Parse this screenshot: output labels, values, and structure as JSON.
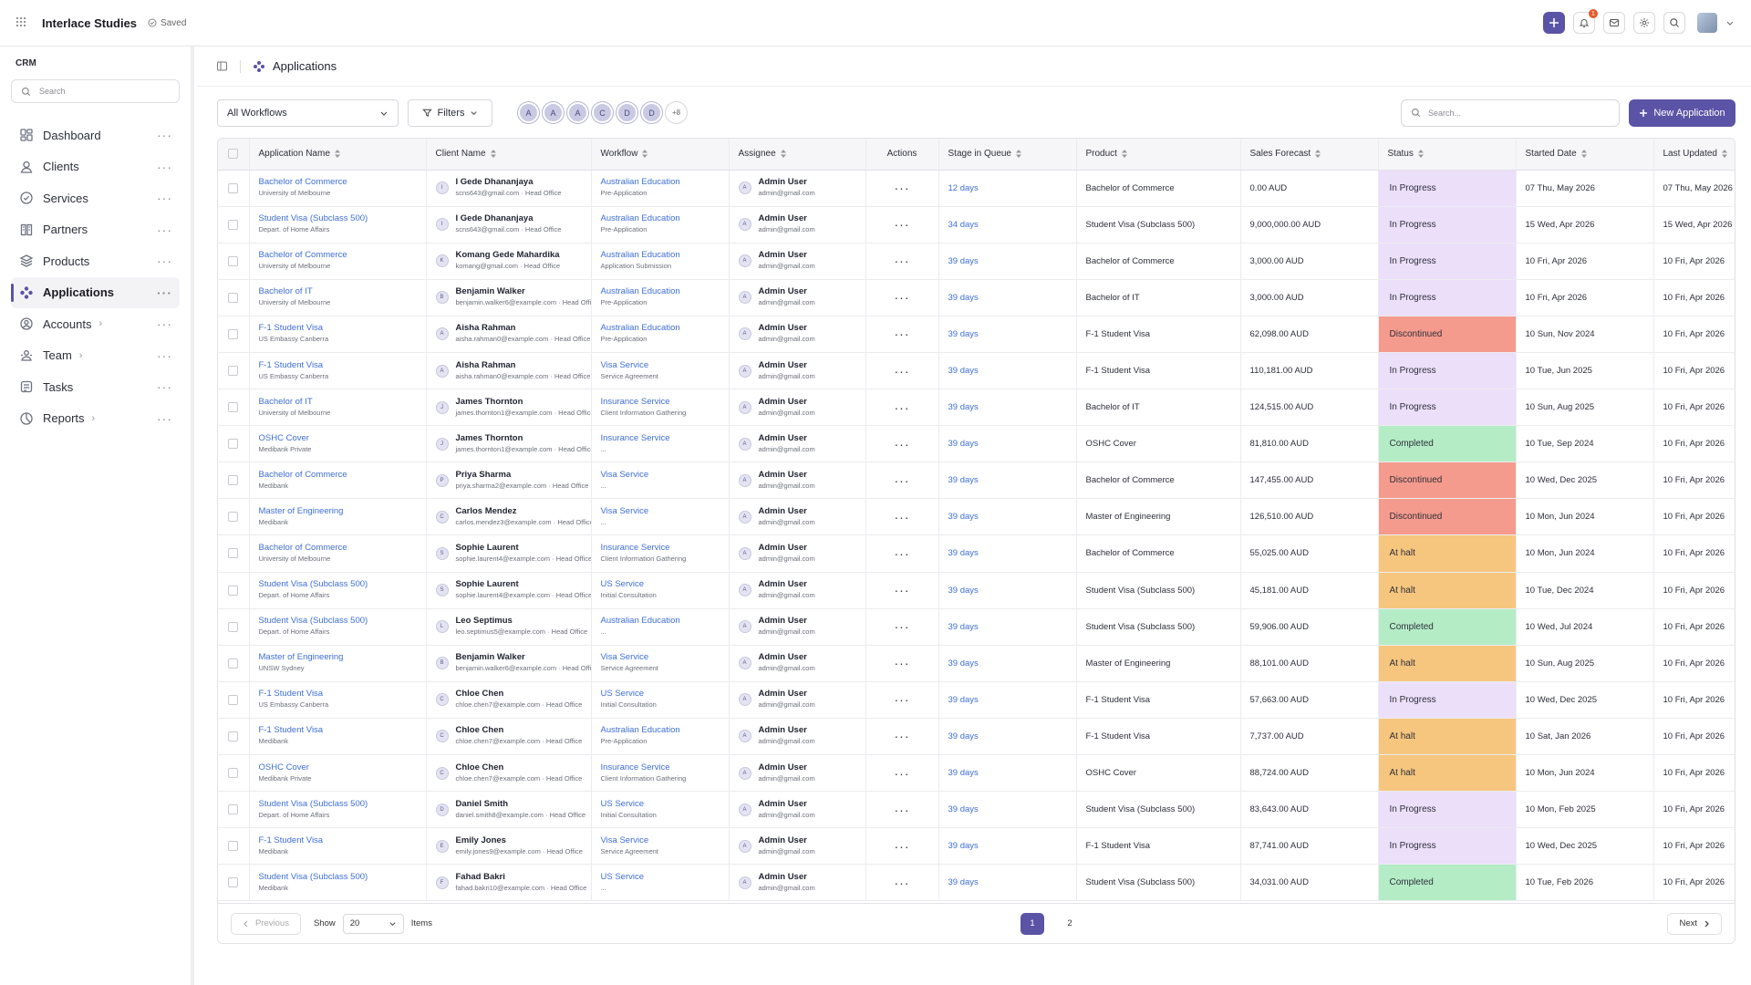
{
  "topbar": {
    "title": "Interlace Studies",
    "saved": "Saved",
    "notif_count": "1"
  },
  "sidebar": {
    "section": "CRM",
    "search_placeholder": "Search",
    "items": [
      {
        "label": "Dashboard",
        "icon": "dashboard-icon",
        "active": false
      },
      {
        "label": "Clients",
        "icon": "user-icon",
        "active": false
      },
      {
        "label": "Services",
        "icon": "check-circle-icon",
        "active": false
      },
      {
        "label": "Partners",
        "icon": "building-icon",
        "active": false
      },
      {
        "label": "Products",
        "icon": "layers-icon",
        "active": false
      },
      {
        "label": "Applications",
        "icon": "applications-icon",
        "active": true
      },
      {
        "label": "Accounts",
        "icon": "account-icon",
        "active": false,
        "expandable": true
      },
      {
        "label": "Team",
        "icon": "team-icon",
        "active": false,
        "expandable": true
      },
      {
        "label": "Tasks",
        "icon": "tasks-icon",
        "active": false
      },
      {
        "label": "Reports",
        "icon": "reports-icon",
        "active": false,
        "expandable": true
      }
    ]
  },
  "page": {
    "title": "Applications"
  },
  "toolbar": {
    "workflow_select": "All Workflows",
    "filters": "Filters",
    "avatars": [
      "A",
      "A",
      "A",
      "C",
      "D",
      "D"
    ],
    "avatars_more": "+8",
    "search_placeholder": "Search...",
    "new_button": "New Application"
  },
  "table": {
    "headers": [
      "Application Name",
      "Client Name",
      "Workflow",
      "Assignee",
      "Actions",
      "Stage in Queue",
      "Product",
      "Sales Forecast",
      "Status",
      "Started Date",
      "Last Updated"
    ],
    "rows": [
      {
        "app": "Bachelor of Commerce",
        "partner": "University of Melbourne",
        "initial": "I",
        "client": "I Gede Dhananjaya",
        "email": "scns643@gmail.com",
        "office": "Head Office",
        "workflow": "Australian Education",
        "stage": "Pre-Application",
        "assignee": "Admin User",
        "assignee_email": "admin@gmail.com",
        "queue": "12 days",
        "product": "Bachelor of Commerce",
        "forecast": "0.00 AUD",
        "status": "In Progress",
        "status_type": "prog",
        "started": "07 Thu, May 2026",
        "updated": "07 Thu, May 2026"
      },
      {
        "app": "Student Visa (Subclass 500)",
        "partner": "Depart. of Home Affairs",
        "initial": "I",
        "client": "I Gede Dhananjaya",
        "email": "scns643@gmail.com",
        "office": "Head Office",
        "workflow": "Australian Education",
        "stage": "Pre-Application",
        "assignee": "Admin User",
        "assignee_email": "admin@gmail.com",
        "queue": "34 days",
        "product": "Student Visa (Subclass 500)",
        "forecast": "9,000,000.00 AUD",
        "status": "In Progress",
        "status_type": "prog",
        "started": "15 Wed, Apr 2026",
        "updated": "15 Wed, Apr 2026"
      },
      {
        "app": "Bachelor of Commerce",
        "partner": "University of Melbourne",
        "initial": "K",
        "client": "Komang Gede Mahardika",
        "email": "komang@gmail.com",
        "office": "Head Office",
        "workflow": "Australian Education",
        "stage": "Application Submission",
        "assignee": "Admin User",
        "assignee_email": "admin@gmail.com",
        "queue": "39 days",
        "product": "Bachelor of Commerce",
        "forecast": "3,000.00 AUD",
        "status": "In Progress",
        "status_type": "prog",
        "started": "10 Fri, Apr 2026",
        "updated": "10 Fri, Apr 2026"
      },
      {
        "app": "Bachelor of IT",
        "partner": "University of Melbourne",
        "initial": "B",
        "client": "Benjamin Walker",
        "email": "benjamin.walker6@example.com",
        "office": "Head Office",
        "workflow": "Australian Education",
        "stage": "Pre-Application",
        "assignee": "Admin User",
        "assignee_email": "admin@gmail.com",
        "queue": "39 days",
        "product": "Bachelor of IT",
        "forecast": "3,000.00 AUD",
        "status": "In Progress",
        "status_type": "prog",
        "started": "10 Fri, Apr 2026",
        "updated": "10 Fri, Apr 2026"
      },
      {
        "app": "F-1 Student Visa",
        "partner": "US Embassy Canberra",
        "initial": "A",
        "client": "Aisha Rahman",
        "email": "aisha.rahman0@example.com",
        "office": "Head Office",
        "workflow": "Australian Education",
        "stage": "Pre-Application",
        "assignee": "Admin User",
        "assignee_email": "admin@gmail.com",
        "queue": "39 days",
        "product": "F-1 Student Visa",
        "forecast": "62,098.00 AUD",
        "status": "Discontinued",
        "status_type": "disc",
        "started": "10 Sun, Nov 2024",
        "updated": "10 Fri, Apr 2026"
      },
      {
        "app": "F-1 Student Visa",
        "partner": "US Embassy Canberra",
        "initial": "A",
        "client": "Aisha Rahman",
        "email": "aisha.rahman0@example.com",
        "office": "Head Office",
        "workflow": "Visa Service",
        "stage": "Service Agreement",
        "assignee": "Admin User",
        "assignee_email": "admin@gmail.com",
        "queue": "39 days",
        "product": "F-1 Student Visa",
        "forecast": "110,181.00 AUD",
        "status": "In Progress",
        "status_type": "prog",
        "started": "10 Tue, Jun 2025",
        "updated": "10 Fri, Apr 2026"
      },
      {
        "app": "Bachelor of IT",
        "partner": "University of Melbourne",
        "initial": "J",
        "client": "James Thornton",
        "email": "james.thornton1@example.com",
        "office": "Head Office",
        "workflow": "Insurance Service",
        "stage": "Client Information Gathering",
        "assignee": "Admin User",
        "assignee_email": "admin@gmail.com",
        "queue": "39 days",
        "product": "Bachelor of IT",
        "forecast": "124,515.00 AUD",
        "status": "In Progress",
        "status_type": "prog",
        "started": "10 Sun, Aug 2025",
        "updated": "10 Fri, Apr 2026"
      },
      {
        "app": "OSHC Cover",
        "partner": "Medibank Private",
        "initial": "J",
        "client": "James Thornton",
        "email": "james.thornton1@example.com",
        "office": "Head Office",
        "workflow": "Insurance Service",
        "stage": "...",
        "assignee": "Admin User",
        "assignee_email": "admin@gmail.com",
        "queue": "39 days",
        "product": "OSHC Cover",
        "forecast": "81,810.00 AUD",
        "status": "Completed",
        "status_type": "comp",
        "started": "10 Tue, Sep 2024",
        "updated": "10 Fri, Apr 2026"
      },
      {
        "app": "Bachelor of Commerce",
        "partner": "Medibank",
        "initial": "P",
        "client": "Priya Sharma",
        "email": "priya.sharma2@example.com",
        "office": "Head Office",
        "workflow": "Visa Service",
        "stage": "...",
        "assignee": "Admin User",
        "assignee_email": "admin@gmail.com",
        "queue": "39 days",
        "product": "Bachelor of Commerce",
        "forecast": "147,455.00 AUD",
        "status": "Discontinued",
        "status_type": "disc",
        "started": "10 Wed, Dec 2025",
        "updated": "10 Fri, Apr 2026"
      },
      {
        "app": "Master of Engineering",
        "partner": "Medibank",
        "initial": "C",
        "client": "Carlos Mendez",
        "email": "carlos.mendez3@example.com",
        "office": "Head Office",
        "workflow": "Visa Service",
        "stage": "...",
        "assignee": "Admin User",
        "assignee_email": "admin@gmail.com",
        "queue": "39 days",
        "product": "Master of Engineering",
        "forecast": "126,510.00 AUD",
        "status": "Discontinued",
        "status_type": "disc",
        "started": "10 Mon, Jun 2024",
        "updated": "10 Fri, Apr 2026"
      },
      {
        "app": "Bachelor of Commerce",
        "partner": "University of Melbourne",
        "initial": "S",
        "client": "Sophie Laurent",
        "email": "sophie.laurent4@example.com",
        "office": "Head Office",
        "workflow": "Insurance Service",
        "stage": "Client Information Gathering",
        "assignee": "Admin User",
        "assignee_email": "admin@gmail.com",
        "queue": "39 days",
        "product": "Bachelor of Commerce",
        "forecast": "55,025.00 AUD",
        "status": "At halt",
        "status_type": "halt",
        "started": "10 Mon, Jun 2024",
        "updated": "10 Fri, Apr 2026"
      },
      {
        "app": "Student Visa (Subclass 500)",
        "partner": "Depart. of Home Affairs",
        "initial": "S",
        "client": "Sophie Laurent",
        "email": "sophie.laurent4@example.com",
        "office": "Head Office",
        "workflow": "US Service",
        "stage": "Initial Consultation",
        "assignee": "Admin User",
        "assignee_email": "admin@gmail.com",
        "queue": "39 days",
        "product": "Student Visa (Subclass 500)",
        "forecast": "45,181.00 AUD",
        "status": "At halt",
        "status_type": "halt",
        "started": "10 Tue, Dec 2024",
        "updated": "10 Fri, Apr 2026"
      },
      {
        "app": "Student Visa (Subclass 500)",
        "partner": "Depart. of Home Affairs",
        "initial": "L",
        "client": "Leo Septimus",
        "email": "leo.septimus5@example.com",
        "office": "Head Office",
        "workflow": "Australian Education",
        "stage": "...",
        "assignee": "Admin User",
        "assignee_email": "admin@gmail.com",
        "queue": "39 days",
        "product": "Student Visa (Subclass 500)",
        "forecast": "59,906.00 AUD",
        "status": "Completed",
        "status_type": "comp",
        "started": "10 Wed, Jul 2024",
        "updated": "10 Fri, Apr 2026"
      },
      {
        "app": "Master of Engineering",
        "partner": "UNSW Sydney",
        "initial": "B",
        "client": "Benjamin Walker",
        "email": "benjamin.walker6@example.com",
        "office": "Head Office",
        "workflow": "Visa Service",
        "stage": "Service Agreement",
        "assignee": "Admin User",
        "assignee_email": "admin@gmail.com",
        "queue": "39 days",
        "product": "Master of Engineering",
        "forecast": "88,101.00 AUD",
        "status": "At halt",
        "status_type": "halt",
        "started": "10 Sun, Aug 2025",
        "updated": "10 Fri, Apr 2026"
      },
      {
        "app": "F-1 Student Visa",
        "partner": "US Embassy Canberra",
        "initial": "C",
        "client": "Chloe Chen",
        "email": "chloe.chen7@example.com",
        "office": "Head Office",
        "workflow": "US Service",
        "stage": "Initial Consultation",
        "assignee": "Admin User",
        "assignee_email": "admin@gmail.com",
        "queue": "39 days",
        "product": "F-1 Student Visa",
        "forecast": "57,663.00 AUD",
        "status": "In Progress",
        "status_type": "prog",
        "started": "10 Wed, Dec 2025",
        "updated": "10 Fri, Apr 2026"
      },
      {
        "app": "F-1 Student Visa",
        "partner": "Medibank",
        "initial": "C",
        "client": "Chloe Chen",
        "email": "chloe.chen7@example.com",
        "office": "Head Office",
        "workflow": "Australian Education",
        "stage": "Pre-Application",
        "assignee": "Admin User",
        "assignee_email": "admin@gmail.com",
        "queue": "39 days",
        "product": "F-1 Student Visa",
        "forecast": "7,737.00 AUD",
        "status": "At halt",
        "status_type": "halt",
        "started": "10 Sat, Jan 2026",
        "updated": "10 Fri, Apr 2026"
      },
      {
        "app": "OSHC Cover",
        "partner": "Medibank Private",
        "initial": "C",
        "client": "Chloe Chen",
        "email": "chloe.chen7@example.com",
        "office": "Head Office",
        "workflow": "Insurance Service",
        "stage": "Client Information Gathering",
        "assignee": "Admin User",
        "assignee_email": "admin@gmail.com",
        "queue": "39 days",
        "product": "OSHC Cover",
        "forecast": "88,724.00 AUD",
        "status": "At halt",
        "status_type": "halt",
        "started": "10 Mon, Jun 2024",
        "updated": "10 Fri, Apr 2026"
      },
      {
        "app": "Student Visa (Subclass 500)",
        "partner": "Depart. of Home Affairs",
        "initial": "D",
        "client": "Daniel Smith",
        "email": "daniel.smith8@example.com",
        "office": "Head Office",
        "workflow": "US Service",
        "stage": "Initial Consultation",
        "assignee": "Admin User",
        "assignee_email": "admin@gmail.com",
        "queue": "39 days",
        "product": "Student Visa (Subclass 500)",
        "forecast": "83,643.00 AUD",
        "status": "In Progress",
        "status_type": "prog",
        "started": "10 Mon, Feb 2025",
        "updated": "10 Fri, Apr 2026"
      },
      {
        "app": "F-1 Student Visa",
        "partner": "Medibank",
        "initial": "E",
        "client": "Emily Jones",
        "email": "emily.jones9@example.com",
        "office": "Head Office",
        "workflow": "Visa Service",
        "stage": "Service Agreement",
        "assignee": "Admin User",
        "assignee_email": "admin@gmail.com",
        "queue": "39 days",
        "product": "F-1 Student Visa",
        "forecast": "87,741.00 AUD",
        "status": "In Progress",
        "status_type": "prog",
        "started": "10 Wed, Dec 2025",
        "updated": "10 Fri, Apr 2026"
      },
      {
        "app": "Student Visa (Subclass 500)",
        "partner": "Medibank",
        "initial": "F",
        "client": "Fahad Bakri",
        "email": "fahad.bakri10@example.com",
        "office": "Head Office",
        "workflow": "US Service",
        "stage": "...",
        "assignee": "Admin User",
        "assignee_email": "admin@gmail.com",
        "queue": "39 days",
        "product": "Student Visa (Subclass 500)",
        "forecast": "34,031.00 AUD",
        "status": "Completed",
        "status_type": "comp",
        "started": "10 Tue, Feb 2026",
        "updated": "10 Fri, Apr 2026"
      }
    ]
  },
  "pagination": {
    "previous": "Previous",
    "show": "Show",
    "page_size": "20",
    "items": "Items",
    "pages": [
      "1",
      "2"
    ],
    "current": "1",
    "next": "Next"
  }
}
